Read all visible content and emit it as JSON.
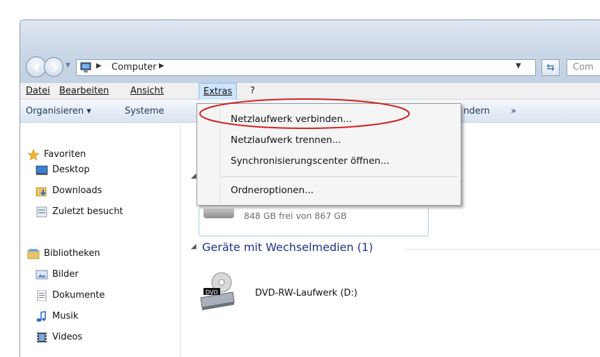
{
  "address": {
    "crumb": "Computer",
    "search_placeholder": "Com"
  },
  "menubar": {
    "items": [
      {
        "label": "Datei"
      },
      {
        "label": "Bearbeiten"
      },
      {
        "label": "Ansicht"
      },
      {
        "label": "Extras"
      },
      {
        "label": "?"
      }
    ]
  },
  "toolbar": {
    "organize": "Organisieren ▾",
    "system": "Systeme",
    "change_partial": "ndern",
    "more": "»"
  },
  "navpane": {
    "favorites": {
      "title": "Favoriten",
      "items": [
        "Desktop",
        "Downloads",
        "Zuletzt besucht"
      ]
    },
    "libraries": {
      "title": "Bibliotheken",
      "items": [
        "Bilder",
        "Dokumente",
        "Musik",
        "Videos"
      ]
    }
  },
  "content": {
    "drive_free_text": "848 GB frei von 867 GB",
    "removable_group": "Geräte mit Wechselmedien (1)",
    "dvd_label": "DVD-RW-Laufwerk (D:)"
  },
  "extras_menu": {
    "items": [
      {
        "label": "Netzlaufwerk verbinden..."
      },
      {
        "label": "Netzlaufwerk trennen..."
      },
      {
        "label": "Synchronisierungscenter öffnen..."
      },
      {
        "label": "Ordneroptionen..."
      }
    ]
  },
  "colors": {
    "annotation_ellipse": "#d42020",
    "menu_highlight": "#cde4fb",
    "group_header": "#1e3287"
  }
}
